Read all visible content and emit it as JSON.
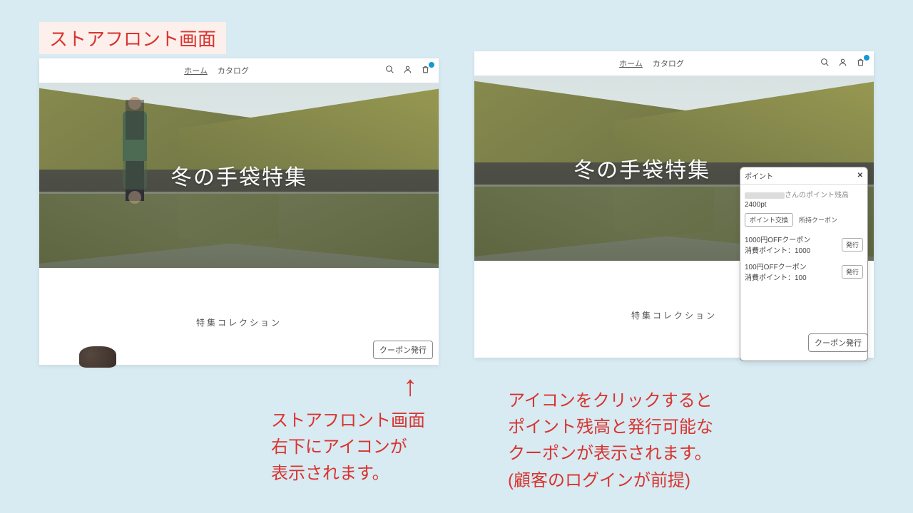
{
  "title": "ストアフロント画面",
  "nav": {
    "home": "ホーム",
    "catalog": "カタログ"
  },
  "hero": {
    "title": "冬の手袋特集"
  },
  "collection": "特集コレクション",
  "coupon_button": "クーポン発行",
  "captions": {
    "left": "ストアフロント画面\n右下にアイコンが\n表示されます。",
    "right": "アイコンをクリックすると\nポイント残高と発行可能な\nクーポンが表示されます。\n(顧客のログインが前提)"
  },
  "popup": {
    "header": "ポイント",
    "close": "✕",
    "user_suffix": "さんのポイント残高",
    "balance": "2400pt",
    "tabs": {
      "exchange": "ポイント交換",
      "owned": "所持クーポン"
    },
    "coupons": [
      {
        "name": "1000円OFFクーポン",
        "cost": "消費ポイント：1000",
        "issue": "発行"
      },
      {
        "name": "100円OFFクーポン",
        "cost": "消費ポイント：100",
        "issue": "発行"
      }
    ]
  }
}
